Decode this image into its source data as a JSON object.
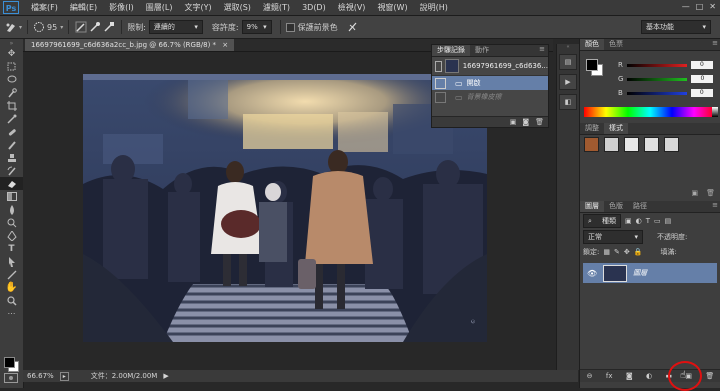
{
  "app": {
    "logo": "Ps"
  },
  "menu": [
    "檔案(F)",
    "編輯(E)",
    "影像(I)",
    "圖層(L)",
    "文字(Y)",
    "選取(S)",
    "濾鏡(T)",
    "3D(D)",
    "檢視(V)",
    "視窗(W)",
    "說明(H)"
  ],
  "window_controls": [
    "—",
    "□",
    "✕"
  ],
  "options": {
    "brush_size": "95",
    "limits_label": "限制:",
    "limits_value": "連續的",
    "tolerance_label": "容許度:",
    "tolerance_value": "9%",
    "protect_fg_label": "保護前景色",
    "workspace": "基本功能"
  },
  "document": {
    "tab_label": "16697961699_c6d636a2cc_b.jpg @ 66.7% (RGB/8) *",
    "close": "×"
  },
  "status": {
    "zoom": "66.67%",
    "doc_info": "文件：2.00M/2.00M"
  },
  "history_panel": {
    "tabs": [
      "步驟記錄",
      "動作"
    ],
    "snapshot": "16697961699_c6d636...",
    "items": [
      "開啟",
      "背景橡皮擦"
    ]
  },
  "color_panel": {
    "tabs": [
      "顏色",
      "色票"
    ],
    "channels": [
      {
        "label": "R",
        "value": "0",
        "color": "#e02020"
      },
      {
        "label": "G",
        "value": "0",
        "color": "#20c020"
      },
      {
        "label": "B",
        "value": "0",
        "color": "#2040e0"
      }
    ]
  },
  "adjust_panel": {
    "tabs": [
      "調整",
      "樣式"
    ]
  },
  "layers_panel": {
    "tabs": [
      "圖層",
      "色版",
      "路徑"
    ],
    "kind_label": "種類",
    "blend_mode": "正常",
    "opacity_label": "不透明度:",
    "fill_label": "填滿:",
    "lock_label": "鎖定:",
    "layer_name": "圖層"
  },
  "colors": {
    "accent": "#657fa8",
    "highlight_circle": "#e01010",
    "panel_bg": "#3e3e3e"
  }
}
